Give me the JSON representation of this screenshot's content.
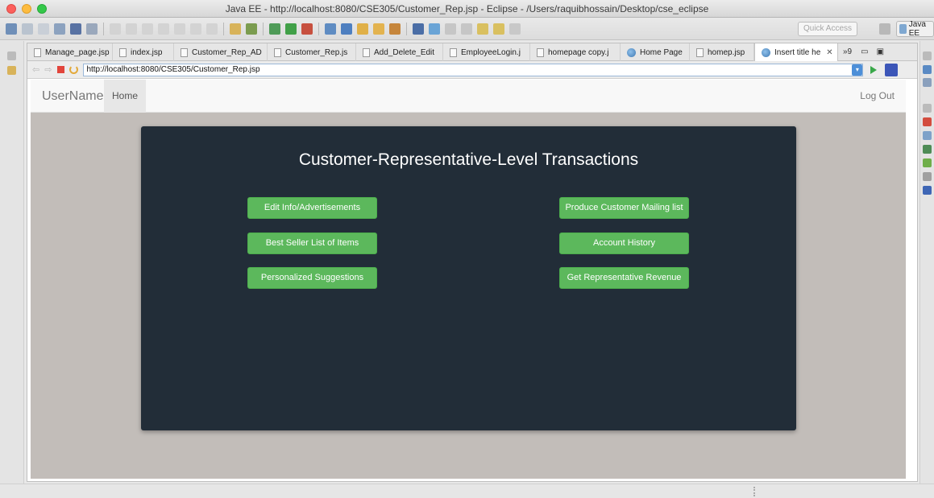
{
  "window": {
    "title": "Java EE - http://localhost:8080/CSE305/Customer_Rep.jsp - Eclipse - /Users/raquibhossain/Desktop/cse_eclipse"
  },
  "toolbar": {
    "quick_access_placeholder": "Quick Access",
    "perspective_label": "Java EE"
  },
  "tabs": [
    {
      "label": "Manage_page.jsp",
      "icon": "file-icon"
    },
    {
      "label": "index.jsp",
      "icon": "file-icon"
    },
    {
      "label": "Customer_Rep_AD",
      "icon": "file-icon"
    },
    {
      "label": "Customer_Rep.js",
      "icon": "file-icon"
    },
    {
      "label": "Add_Delete_Edit",
      "icon": "file-icon"
    },
    {
      "label": "EmployeeLogin.j",
      "icon": "file-icon"
    },
    {
      "label": "homepage copy.j",
      "icon": "file-icon"
    },
    {
      "label": "Home Page",
      "icon": "globe-icon"
    },
    {
      "label": "homep.jsp",
      "icon": "file-icon"
    },
    {
      "label": "Insert title he",
      "icon": "globe-icon",
      "active": true
    }
  ],
  "tab_overflow": "»9",
  "browser": {
    "url": "http://localhost:8080/CSE305/Customer_Rep.jsp"
  },
  "site_nav": {
    "brand": "UserName",
    "home": "Home",
    "logout": "Log Out"
  },
  "panel": {
    "title": "Customer-Representative-Level Transactions",
    "left_buttons": [
      "Edit Info/Advertisements",
      "Best Seller List of Items",
      "Personalized Suggestions"
    ],
    "right_buttons": [
      "Produce Customer Mailing list",
      "Account History",
      "Get Representative Revenue"
    ]
  },
  "colors": {
    "panel_bg": "#222d38",
    "button_green": "#5cb85c",
    "page_bg": "#c2bdb9"
  }
}
